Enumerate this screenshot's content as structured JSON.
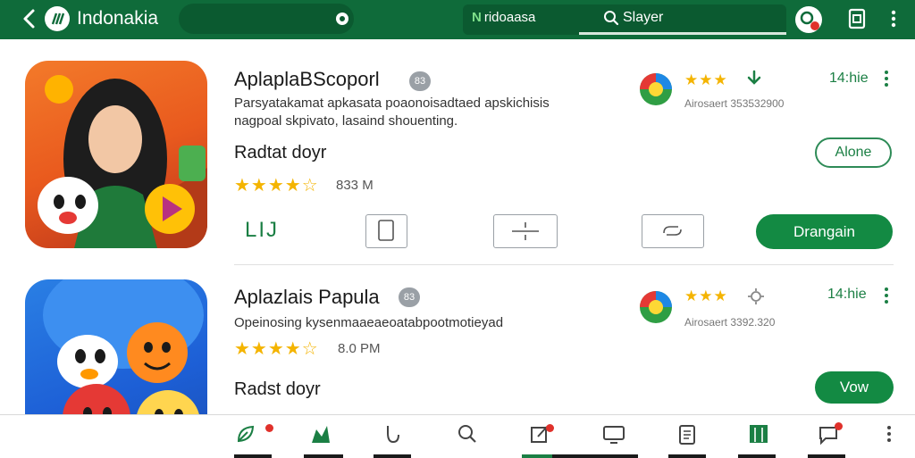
{
  "header": {
    "title": "Indonakia",
    "tag_label": "ridoaasa",
    "tag_mark": "N",
    "search_label": "Slayer",
    "icons": [
      "back-arrow-icon",
      "app-logo-icon",
      "search-icon",
      "profile-icon",
      "cast-icon",
      "more-vert-icon"
    ]
  },
  "apps": [
    {
      "title": "AplaplaBScoporl",
      "badge": "83",
      "description_line1": "Parsyatakamat apkasata poaonoisadtaed apskichisis",
      "description_line2": "nagpoal skpivato, lasaind shouenting.",
      "section_label": "Radtat doyr",
      "rating_stars": "★★★★☆",
      "rating_value": 4.5,
      "size": "833 M",
      "mini_stars": "★★★",
      "mini_info": "Airosaert 353532900",
      "count": "14:hie",
      "li_label": "LIJ",
      "outline_button": "Alone",
      "primary_button": "Drangain",
      "tool_icons": [
        "tablet-icon",
        "expand-icon",
        "link-icon"
      ]
    },
    {
      "title": "Aplazlais Papula",
      "badge": "83",
      "description_line1": "Opeinosing kysenmaaeaeoatabpootmotieyad",
      "section_label": "Radst doyr",
      "rating_stars": "★★★★☆",
      "rating_value": 4.5,
      "size": "8.0 PM",
      "mini_stars": "★★★",
      "mini_info": "Airosaert 3392.320",
      "count": "14:hie",
      "primary_button": "Vow"
    }
  ],
  "bottom_nav": {
    "icons": [
      "leaf-icon",
      "chart-icon",
      "gesture-icon",
      "search-icon",
      "edit-icon",
      "tv-icon",
      "clipboard-icon",
      "book-icon",
      "chat-icon",
      "more-vert-icon"
    ]
  },
  "colors": {
    "header_green": "#0f6b3a",
    "accent_green": "#138a43",
    "star_yellow": "#f4b400",
    "badge_red": "#e0312b"
  }
}
